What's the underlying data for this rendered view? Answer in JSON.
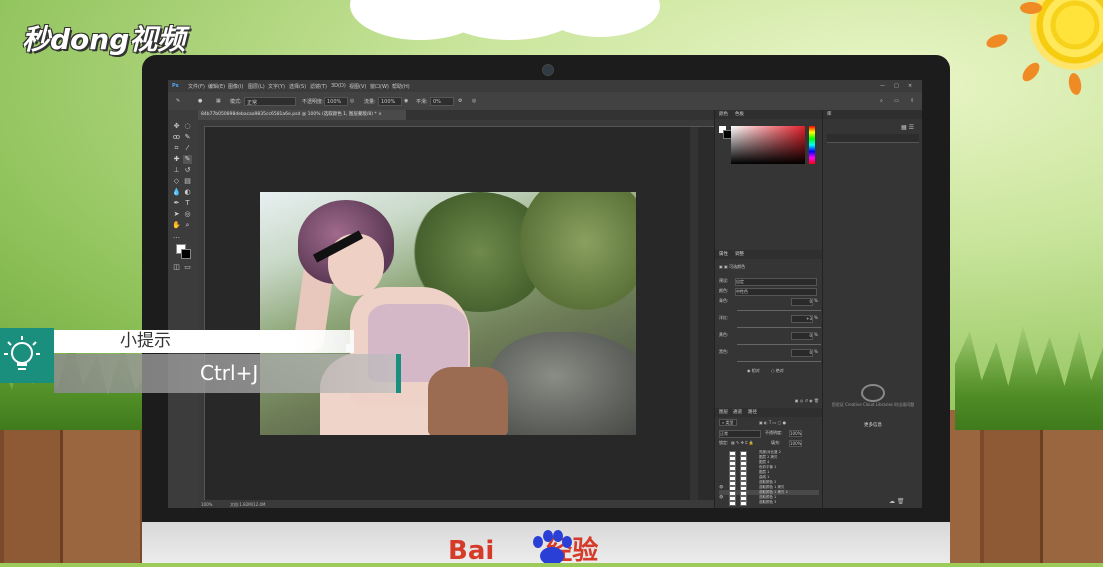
{
  "overlay": {
    "logo_text": "秒dong视频",
    "tip_title": "小提示",
    "tip_key": "Ctrl+J",
    "baidu_text": "Bai",
    "baidu_jingyan": "经验"
  },
  "photoshop": {
    "menu": [
      "文件(F)",
      "编辑(E)",
      "图像(I)",
      "图层(L)",
      "文字(Y)",
      "选择(S)",
      "滤镜(T)",
      "3D(D)",
      "视图(V)",
      "窗口(W)",
      "帮助(H)"
    ],
    "options": {
      "mode_label": "模式:",
      "mode_value": "正常",
      "opacity_label": "不透明度:",
      "opacity_value": "100%",
      "flow_label": "流量:",
      "flow_value": "100%",
      "smooth_label": "平滑:",
      "smooth_value": "0%"
    },
    "doc_tab": "84b77b050898debacaa9835cc6581a6e.psd @ 100% (选取颜色 1, 图层蒙版/8) * ×",
    "status": {
      "zoom": "100%",
      "doc": "文档:1.82M/12.4M"
    },
    "color_panel": {
      "tab1": "颜色",
      "tab2": "色板"
    },
    "properties": {
      "tab1": "属性",
      "tab2": "调整",
      "title": "可选颜色",
      "preset_label": "预设:",
      "preset_value": "自定",
      "colors_label": "颜色:",
      "colors_value": "中性色",
      "rows": [
        {
          "label": "青色:",
          "value": "0",
          "unit": "%"
        },
        {
          "label": "洋红:",
          "value": "+3",
          "unit": "%"
        },
        {
          "label": "黄色:",
          "value": "0",
          "unit": "%"
        },
        {
          "label": "黑色:",
          "value": "0",
          "unit": "%"
        }
      ],
      "radio1": "相对",
      "radio2": "绝对"
    },
    "layers_panel": {
      "tab1": "图层",
      "tab2": "通道",
      "tab3": "路径",
      "kind_label": "类型",
      "blend_value": "正常",
      "opacity_label": "不透明度:",
      "opacity_value": "100%",
      "lock_label": "锁定:",
      "fill_label": "填充:",
      "fill_value": "100%",
      "layers": [
        {
          "name": "亮度/对比度 2"
        },
        {
          "name": "图层 2 拷贝"
        },
        {
          "name": "图层 4"
        },
        {
          "name": "色彩平衡 1"
        },
        {
          "name": "图层 1"
        },
        {
          "name": "曲线 1"
        },
        {
          "name": "选取颜色 2"
        },
        {
          "name": "选取颜色 1 拷贝"
        },
        {
          "name": "选取颜色 1 拷贝 2"
        },
        {
          "name": "选取颜色 1"
        },
        {
          "name": "选取颜色 3"
        }
      ]
    },
    "libraries": {
      "tab": "库",
      "text": "您验证 Creative Cloud Libraries 时出现问题",
      "button": "更多信息"
    }
  },
  "colors": {
    "tip_accent": "#1a8f7e",
    "baidu_red": "#d63b2a",
    "baidu_blue": "#2a3fd6"
  }
}
